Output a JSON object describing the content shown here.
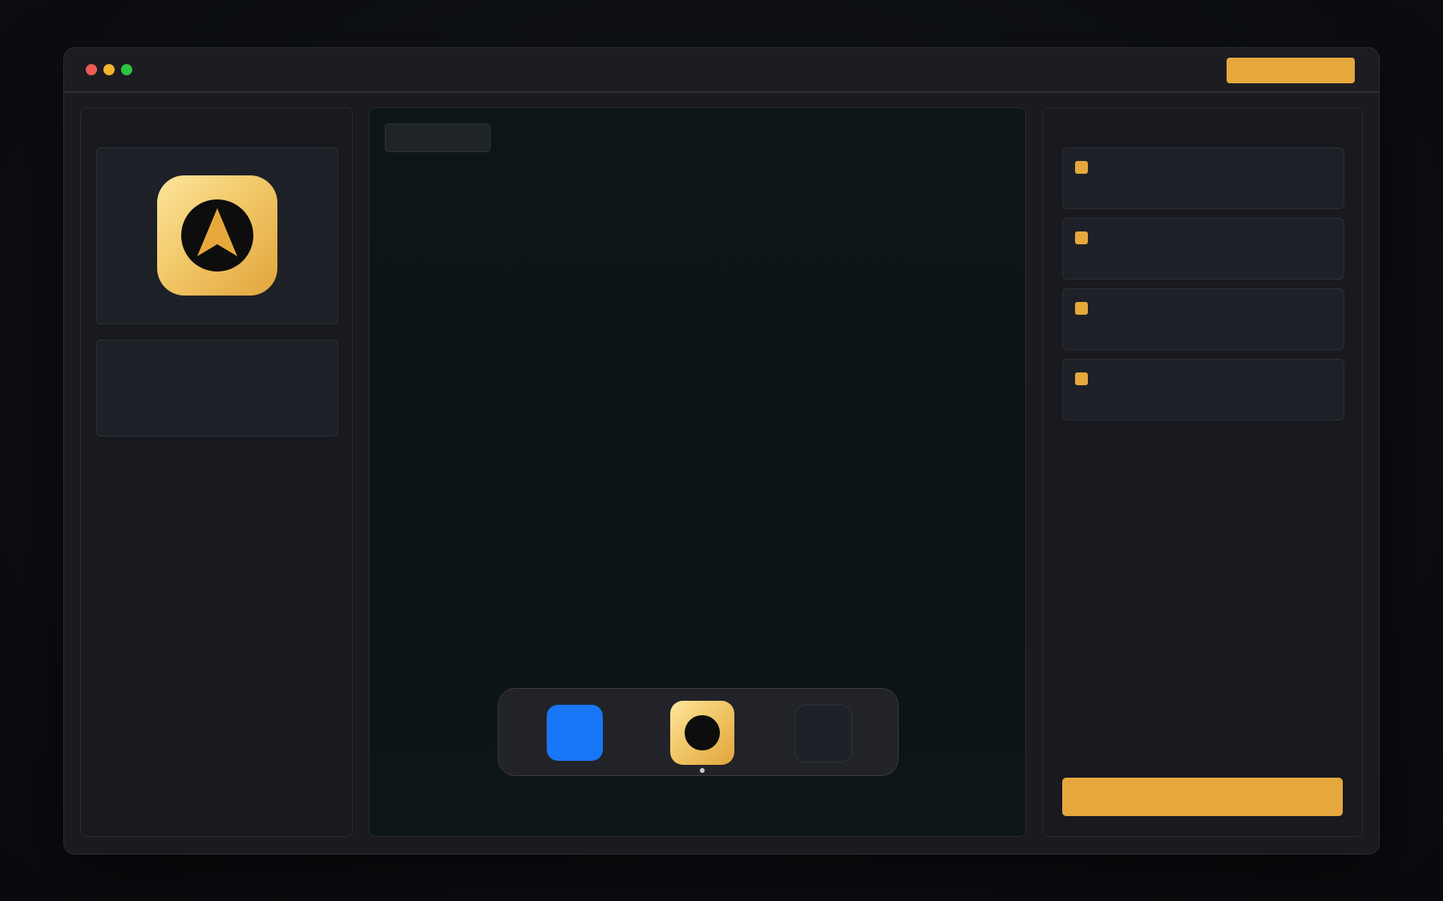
{
  "titlebar": {
    "action_label": ""
  },
  "left_panel": {
    "app_icon": "navigation-arrow-icon",
    "info_text": ""
  },
  "center": {
    "pill_label": "",
    "dock": [
      {
        "name": "blue-app",
        "color": "#1877f6",
        "active": false
      },
      {
        "name": "gold-app",
        "color": "#e6a83d",
        "active": true
      },
      {
        "name": "empty-slot",
        "color": "#1e2228",
        "active": false
      }
    ]
  },
  "right_panel": {
    "items": [
      {
        "label": ""
      },
      {
        "label": ""
      },
      {
        "label": ""
      },
      {
        "label": ""
      }
    ],
    "primary_label": ""
  },
  "colors": {
    "accent": "#e6a83d",
    "blue": "#1877f6",
    "background": "#0c0e12",
    "window": "#1a1a1f"
  }
}
